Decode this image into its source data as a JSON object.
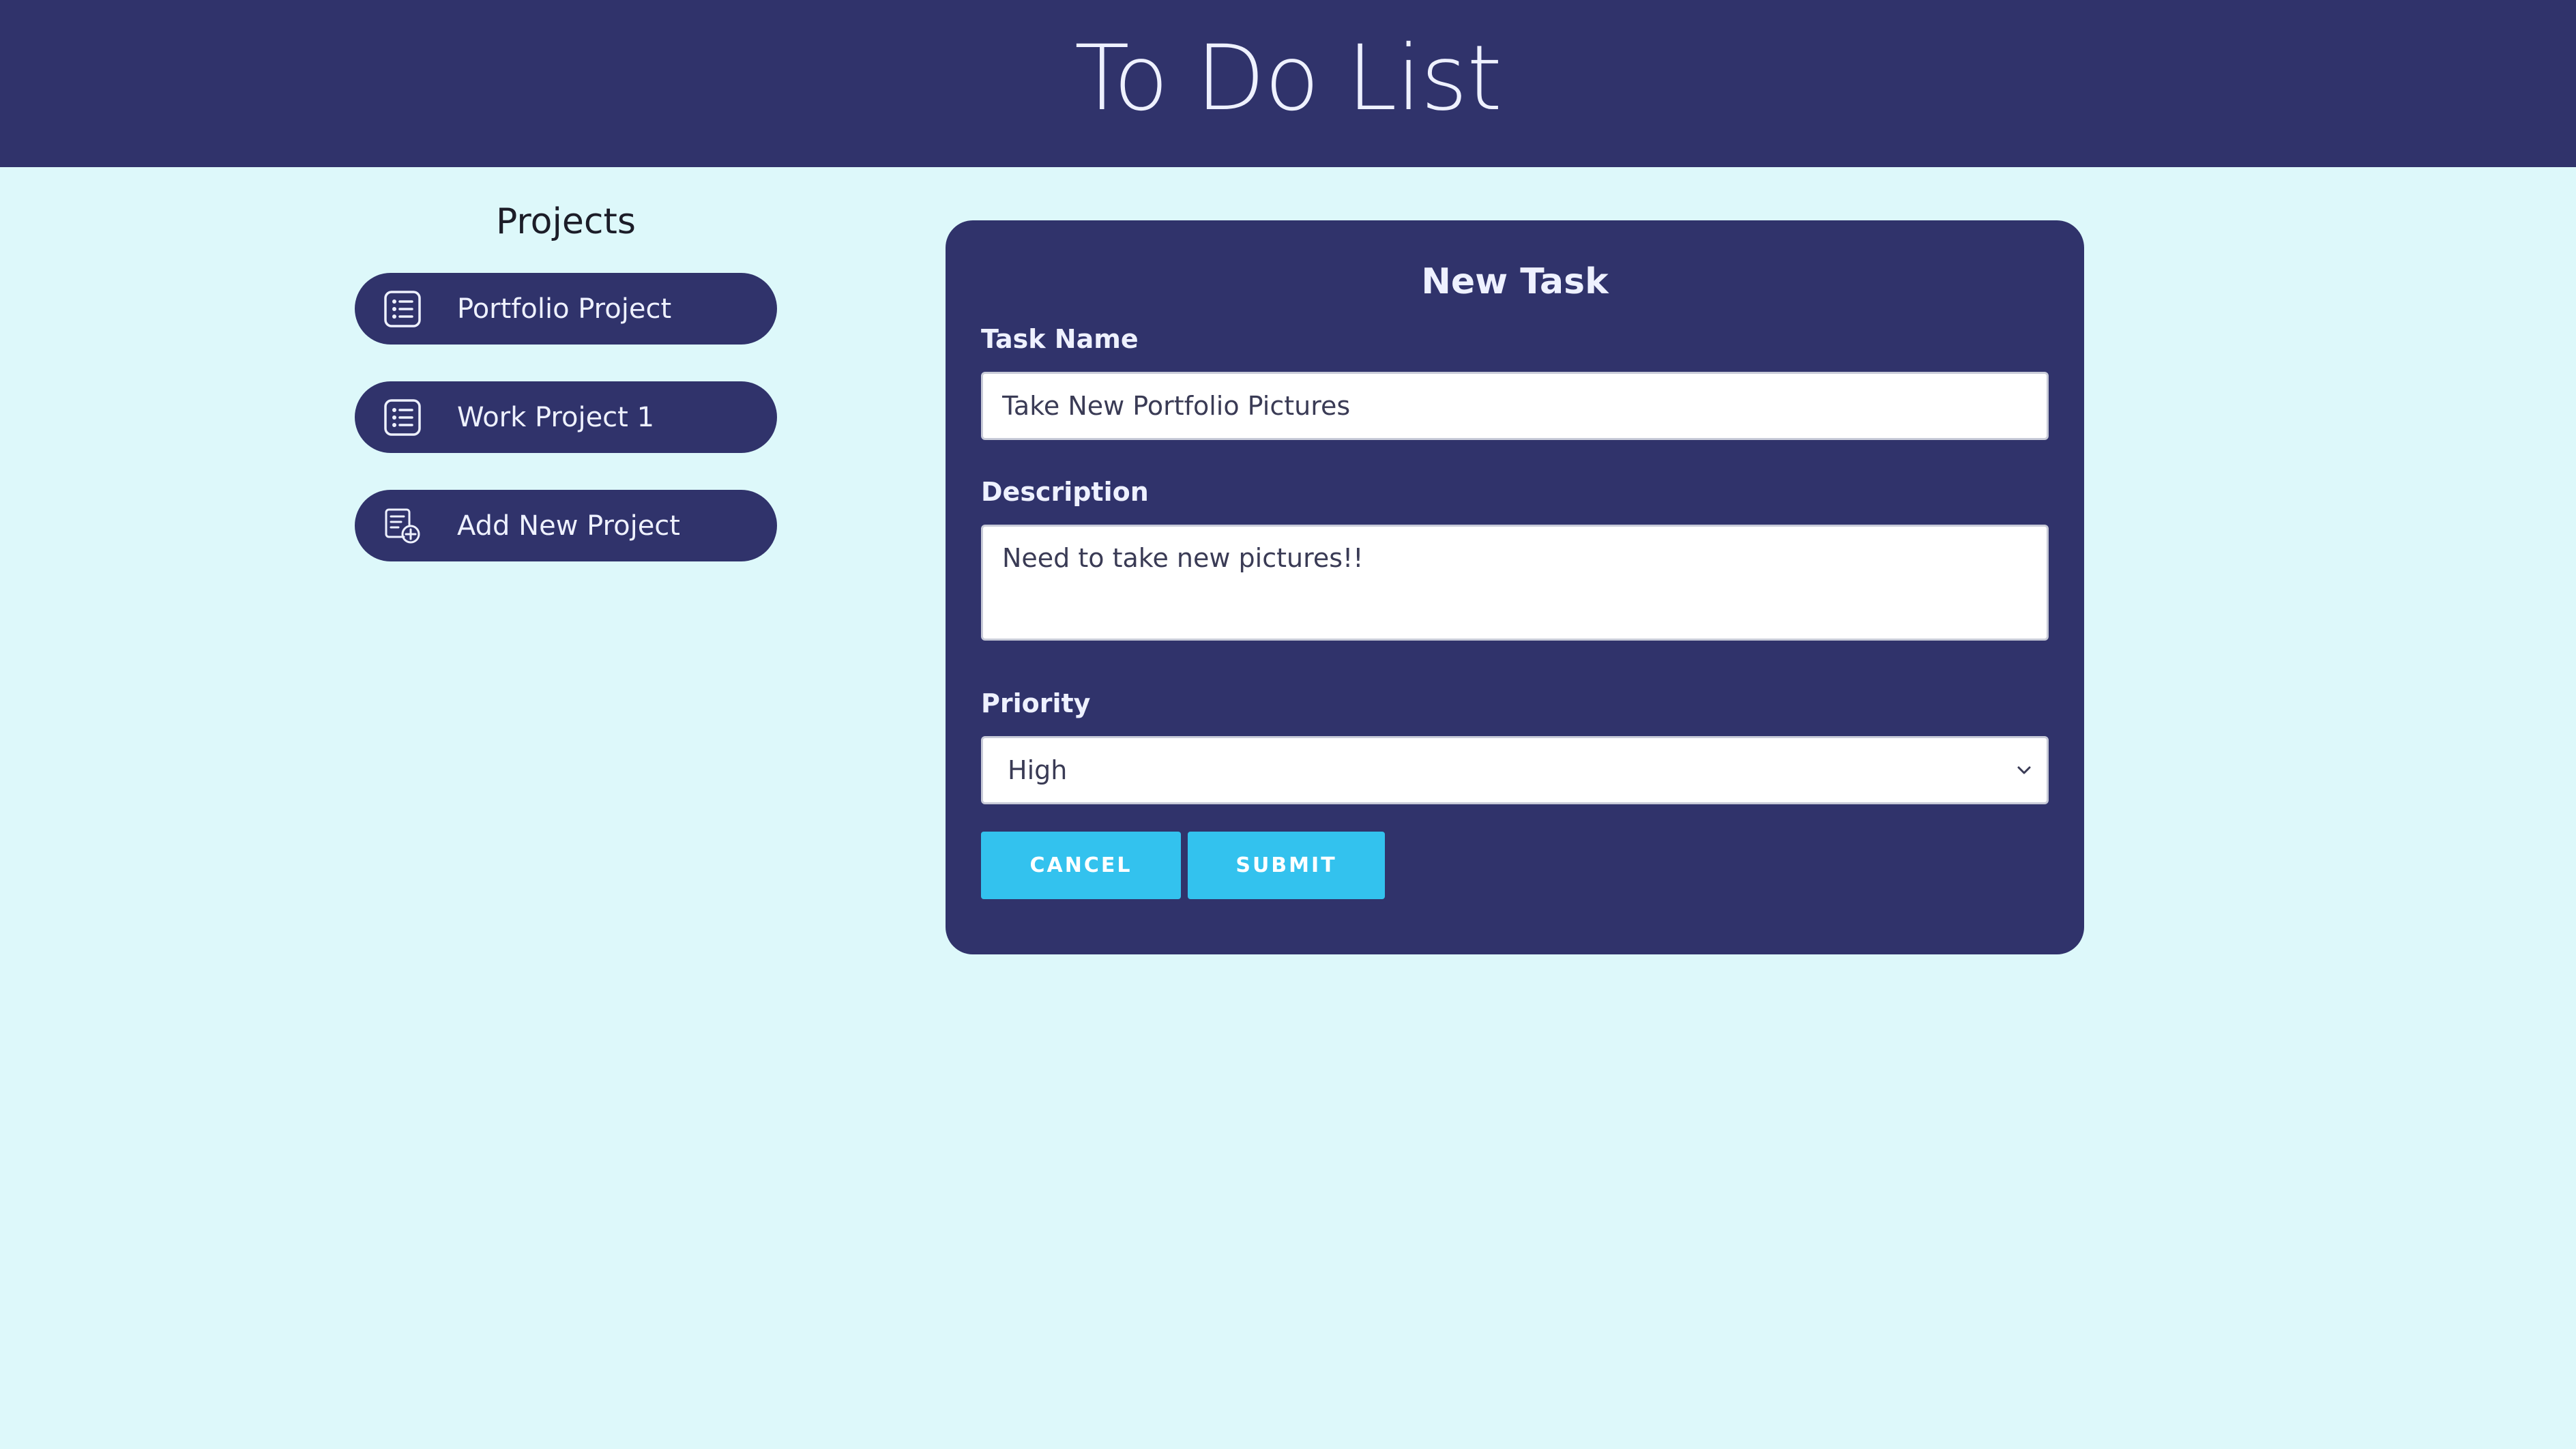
{
  "header": {
    "title": "To Do List"
  },
  "sidebar": {
    "title": "Projects",
    "items": [
      {
        "label": "Portfolio Project",
        "icon": "list-icon"
      },
      {
        "label": "Work Project 1",
        "icon": "list-icon"
      },
      {
        "label": "Add New Project",
        "icon": "add-list-icon"
      }
    ]
  },
  "form": {
    "title": "New Task",
    "task_name": {
      "label": "Task Name",
      "value": "Take New Portfolio Pictures"
    },
    "description": {
      "label": "Description",
      "value": "Need to take new pictures!!"
    },
    "priority": {
      "label": "Priority",
      "value": "High"
    },
    "cancel_label": "CANCEL",
    "submit_label": "SUBMIT"
  },
  "colors": {
    "header_bg": "#30336b",
    "page_bg": "#ddf8fa",
    "panel_bg": "#30336b",
    "button_bg": "#33c2ee"
  }
}
